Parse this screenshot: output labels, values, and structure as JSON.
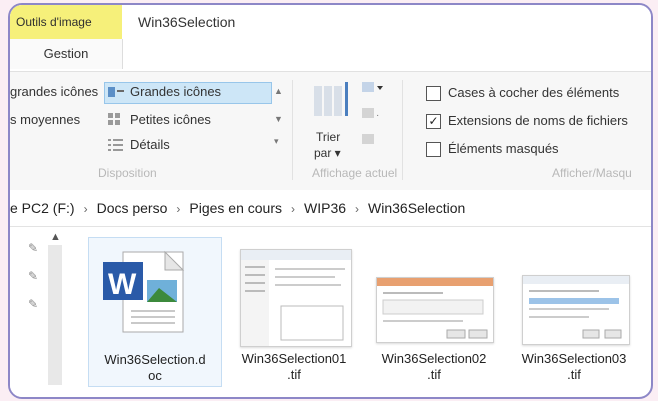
{
  "ribbon_tabs": {
    "context_group": "Outils d'image",
    "context_tab": "Gestion",
    "window_title": "Win36Selection"
  },
  "layout_group": {
    "items": [
      "grandes icônes",
      "Grandes icônes",
      "s moyennes",
      "Petites icônes",
      "Détails"
    ],
    "label": "Disposition"
  },
  "current_view_group": {
    "sort_label": "Trier",
    "sort_sub": "par",
    "label": "Affichage actuel"
  },
  "show_hide_group": {
    "options": [
      {
        "label": "Cases à cocher des éléments",
        "checked": false
      },
      {
        "label": "Extensions de noms de fichiers",
        "checked": true
      },
      {
        "label": "Éléments masqués",
        "checked": false
      }
    ],
    "label": "Afficher/Masqu"
  },
  "breadcrumb": [
    "e PC2 (F:)",
    "Docs perso",
    "Piges en cours",
    "WIP36",
    "Win36Selection"
  ],
  "files": [
    {
      "name_line1": "Win36Selection.d",
      "name_line2": "oc"
    },
    {
      "name_line1": "Win36Selection01",
      "name_line2": ".tif"
    },
    {
      "name_line1": "Win36Selection02",
      "name_line2": ".tif"
    },
    {
      "name_line1": "Win36Selection03",
      "name_line2": ".tif"
    }
  ]
}
